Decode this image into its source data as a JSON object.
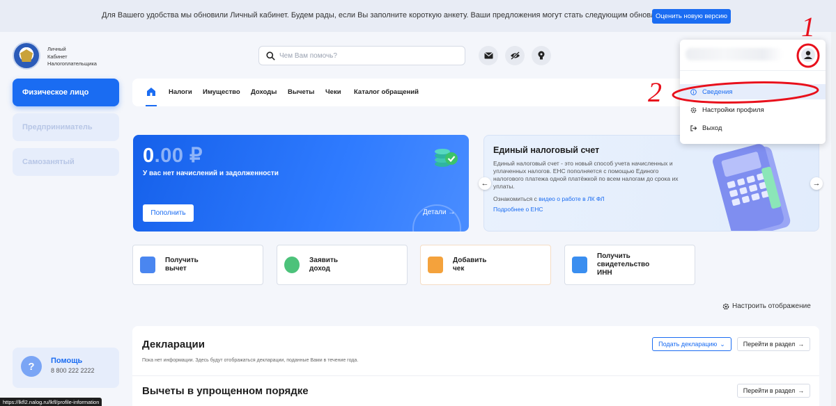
{
  "banner": {
    "text": "Для Вашего удобства мы обновили Личный кабинет. Будем рады, если Вы заполните короткую анкету. Ваши предложения могут стать следующим обновлением",
    "button": "Оценить новую версию"
  },
  "header": {
    "logo_line1": "Личный",
    "logo_line2": "Кабинет",
    "logo_line3": "Налогоплательщика",
    "search_placeholder": "Чем Вам помочь?",
    "icons": [
      "mail-icon",
      "eye-off-icon",
      "lightbulb-icon"
    ]
  },
  "sidebar": {
    "items": [
      {
        "label": "Физическое лицо",
        "active": true
      },
      {
        "label": "Предприниматель",
        "active": false
      },
      {
        "label": "Самозанятый",
        "active": false
      }
    ],
    "help_title": "Помощь",
    "help_phone": "8 800 222 2222"
  },
  "nav": {
    "items": [
      "Налоги",
      "Имущество",
      "Доходы",
      "Вычеты",
      "Чеки",
      "Каталог обращений"
    ]
  },
  "balance": {
    "amount_int": "0",
    "amount_dec": ".00 ₽",
    "subtitle": "У вас нет начислений и задолженности",
    "button": "Пополнить",
    "details": "Детали"
  },
  "ens": {
    "title": "Единый налоговый счет",
    "description": "Единый налоговый счет - это новый способ учета начисленных и уплаченных налогов. ЕНС пополняется с помощью Единого налогового платежа одной платёжкой по всем налогам до срока их уплаты.",
    "link_prefix": "Ознакомиться с",
    "link_text": "видео о работе в ЛК ФЛ",
    "link2": "Подробнее о ЕНС"
  },
  "tiles": [
    {
      "line1": "Получить",
      "line2": "вычет",
      "line3": ""
    },
    {
      "line1": "Заявить",
      "line2": "доход",
      "line3": ""
    },
    {
      "line1": "Добавить",
      "line2": "чек",
      "line3": ""
    },
    {
      "line1": "Получить",
      "line2": "свидетельство",
      "line3": "ИНН"
    }
  ],
  "settings_display": "Настроить отображение",
  "declarations": {
    "title": "Декларации",
    "subtitle": "Пока нет информации. Здесь будут отображаться декларации, поданные Вами в течение года.",
    "submit_button": "Подать декларацию",
    "goto_button": "Перейти в раздел"
  },
  "deductions": {
    "title": "Вычеты в упрощенном порядке",
    "goto_button": "Перейти в раздел"
  },
  "dropdown": {
    "items": [
      {
        "label": "Сведения",
        "icon": "info-icon",
        "active": true
      },
      {
        "label": "Настройки профиля",
        "icon": "gear-icon",
        "active": false
      },
      {
        "label": "Выход",
        "icon": "logout-icon",
        "active": false
      }
    ]
  },
  "annotations": {
    "mark1": "1",
    "mark2": "2"
  },
  "status_url": "https://lkfl2.nalog.ru/lkfl/profile-information",
  "colors": {
    "accent": "#1a6cf2",
    "annotation": "#e8101c"
  }
}
